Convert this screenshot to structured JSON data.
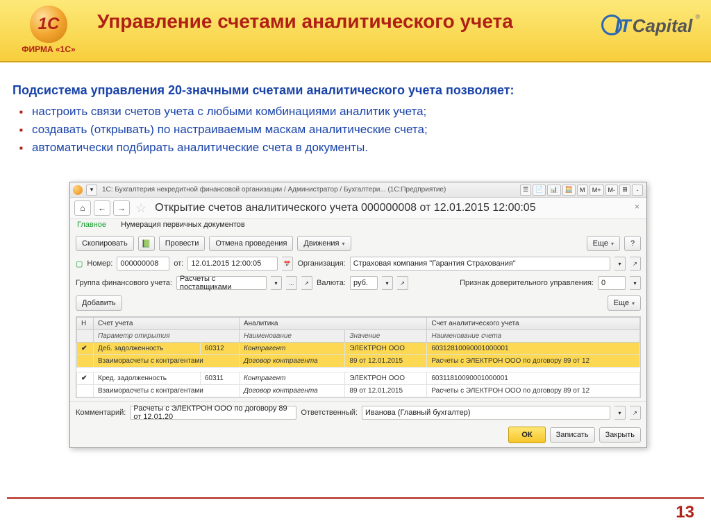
{
  "slide": {
    "title": "Управление счетами аналитического учета",
    "intro": "Подсистема управления 20-значными счетами аналитического учета позволяет:",
    "bullets": [
      "настроить связи счетов учета с любыми комбинациями аналитик учета;",
      "создавать (открывать) по настраиваемым маскам аналитические счета;",
      "автоматически подбирать аналитические счета в документы."
    ],
    "page_num": "13",
    "brand_sub": "ФИРМА «1С»",
    "brand_ball": "1С",
    "itcap_it": "IT",
    "itcap_cap": "Capital"
  },
  "app": {
    "titlebar": "1С: Бухгалтерия некредитной финансовой организации / Администратор / Бухгалтери... (1С:Предприятие)",
    "tbtn_m": "М",
    "tbtn_mplus": "М+",
    "tbtn_mminus": "М-",
    "doc_title": "Открытие счетов аналитического учета 000000008 от 12.01.2015 12:00:05",
    "tabs": {
      "main": "Главное",
      "num": "Нумерация первичных документов"
    },
    "toolbar": {
      "copy": "Скопировать",
      "post": "Провести",
      "unpost": "Отмена проведения",
      "moves": "Движения",
      "more": "Еще",
      "help": "?"
    },
    "fields": {
      "num_lbl": "Номер:",
      "num_val": "000000008",
      "date_lbl": "от:",
      "date_val": "12.01.2015 12:00:05",
      "org_lbl": "Организация:",
      "org_val": "Страховая компания \"Гарантия Страхования\"",
      "group_lbl": "Группа финансового учета:",
      "group_val": "Расчеты с поставщиками",
      "curr_lbl": "Валюта:",
      "curr_val": "руб.",
      "trust_lbl": "Признак доверительного управления:",
      "trust_val": "0",
      "add": "Добавить",
      "more2": "Еще"
    },
    "headers": {
      "n": "Н",
      "acct": "Счет учета",
      "analyt": "Аналитика",
      "analacct": "Счет аналитического учета",
      "open_param": "Параметр открытия",
      "name": "Наименование",
      "value": "Значение",
      "acct_name": "Наименование счета"
    },
    "rows": [
      {
        "sel": true,
        "type": "Деб. задолженность",
        "code": "60312",
        "an_name": "Контрагент",
        "an_val": "ЭЛЕКТРОН ООО",
        "acct": "60312810090001000001",
        "sub_type": "Взаиморасчеты с контрагентами",
        "sub_an_name": "Договор контрагента",
        "sub_an_val": "89 от 12.01.2015",
        "sub_acct": "Расчеты с ЭЛЕКТРОН ООО по договору 89 от 12"
      },
      {
        "sel": false,
        "type": "Кред. задолженность",
        "code": "60311",
        "an_name": "Контрагент",
        "an_val": "ЭЛЕКТРОН ООО",
        "acct": "60311810090001000001",
        "sub_type": "Взаиморасчеты с контрагентами",
        "sub_an_name": "Договор контрагента",
        "sub_an_val": "89 от 12.01.2015",
        "sub_acct": "Расчеты с ЭЛЕКТРОН ООО по договору 89 от 12"
      }
    ],
    "footer": {
      "comment_lbl": "Комментарий:",
      "comment_val": "Расчеты с ЭЛЕКТРОН ООО по договору 89 от 12.01.20",
      "resp_lbl": "Ответственный:",
      "resp_val": "Иванова (Главный бухгалтер)",
      "ok": "ОК",
      "save": "Записать",
      "close": "Закрыть"
    }
  }
}
